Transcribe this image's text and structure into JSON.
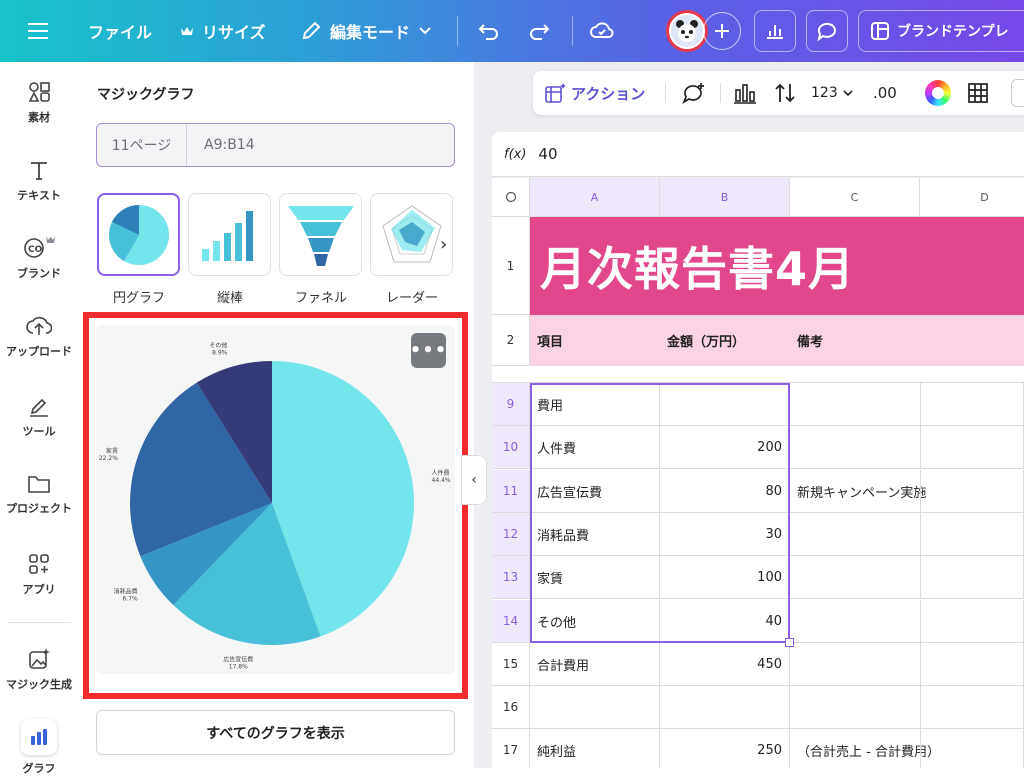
{
  "topbar": {
    "file": "ファイル",
    "resize": "リサイズ",
    "edit_mode": "編集モード",
    "brand_template": "ブランドテンプレ"
  },
  "rail": {
    "items": [
      {
        "label": "素材",
        "icon": "elements-icon"
      },
      {
        "label": "テキスト",
        "icon": "text-icon"
      },
      {
        "label": "ブランド",
        "icon": "brand-icon"
      },
      {
        "label": "アップロード",
        "icon": "upload-icon"
      },
      {
        "label": "ツール",
        "icon": "draw-tool-icon"
      },
      {
        "label": "プロジェクト",
        "icon": "folder-icon"
      },
      {
        "label": "アプリ",
        "icon": "apps-icon"
      },
      {
        "label": "マジック生成",
        "icon": "magic-image-icon"
      },
      {
        "label": "グラフ",
        "icon": "chart-icon"
      }
    ]
  },
  "panel": {
    "title": "マジックグラフ",
    "range_page": "11ページ",
    "range_ref": "A9:B14",
    "chart_types": [
      "円グラフ",
      "縦棒",
      "ファネル",
      "レーダー"
    ],
    "show_all": "すべてのグラフを表示",
    "more": "•••"
  },
  "toolbar": {
    "action": "アクション",
    "number_format": "123",
    "decimal": ".00"
  },
  "formula": {
    "fx": "f(x)",
    "value": "40"
  },
  "sheet": {
    "columns": [
      "A",
      "B",
      "C",
      "D"
    ],
    "title": "月次報告書4月",
    "header_row": {
      "A": "項目",
      "B": "金額（万円）",
      "C": "備考"
    },
    "rows": [
      {
        "n": "9",
        "a": "費用",
        "b": "",
        "c": ""
      },
      {
        "n": "10",
        "a": "人件費",
        "b": "200",
        "c": ""
      },
      {
        "n": "11",
        "a": "広告宣伝費",
        "b": "80",
        "c": "新規キャンペーン実施"
      },
      {
        "n": "12",
        "a": "消耗品費",
        "b": "30",
        "c": ""
      },
      {
        "n": "13",
        "a": "家賃",
        "b": "100",
        "c": ""
      },
      {
        "n": "14",
        "a": "その他",
        "b": "40",
        "c": ""
      },
      {
        "n": "15",
        "a": "合計費用",
        "b": "450",
        "c": ""
      },
      {
        "n": "16",
        "a": "",
        "b": "",
        "c": ""
      },
      {
        "n": "17",
        "a": "純利益",
        "b": "250",
        "c": "（合計売上 - 合計費用）"
      }
    ]
  },
  "colors": {
    "accent": "#8b5ee3",
    "title_bg": "#e2478c",
    "header_bg": "#fcd3e4",
    "highlight_frame": "#f02b2b"
  },
  "chart_data": {
    "type": "pie",
    "slices": [
      {
        "label": "人件費",
        "pct": "44.4%",
        "value": 200,
        "color": "#74e5ea"
      },
      {
        "label": "広告宣伝費",
        "pct": "17.8%",
        "value": 80,
        "color": "#48c0da"
      },
      {
        "label": "消耗品費",
        "pct": "6.7%",
        "value": 30,
        "color": "#3596c6"
      },
      {
        "label": "家賃",
        "pct": "22.2%",
        "value": 100,
        "color": "#2f66a5"
      },
      {
        "label": "その他",
        "pct": "8.9%",
        "value": 40,
        "color": "#343b78"
      }
    ]
  }
}
